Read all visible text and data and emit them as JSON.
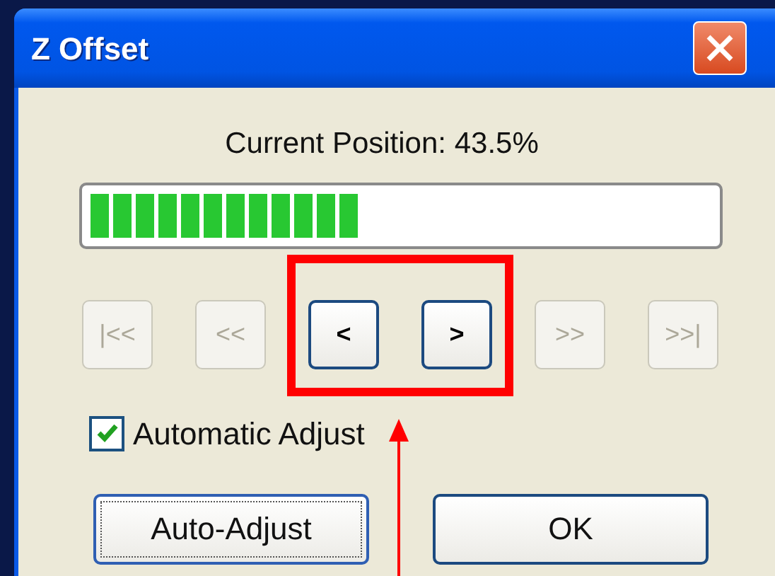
{
  "window": {
    "title": "Z Offset"
  },
  "position": {
    "label": "Current Position: 43.5%",
    "level": 0.435
  },
  "nav_buttons": [
    {
      "label": "|<<",
      "disabled": true
    },
    {
      "label": "<<",
      "disabled": true
    },
    {
      "label": "<",
      "disabled": false
    },
    {
      "label": ">",
      "disabled": false
    },
    {
      "label": ">>",
      "disabled": true
    },
    {
      "label": ">>|",
      "disabled": true
    }
  ],
  "checkbox": {
    "label": "Automatic Adjust",
    "checked": true
  },
  "buttons": [
    {
      "label": "Auto-Adjust",
      "focused": true
    },
    {
      "label": "OK",
      "focused": false
    }
  ]
}
